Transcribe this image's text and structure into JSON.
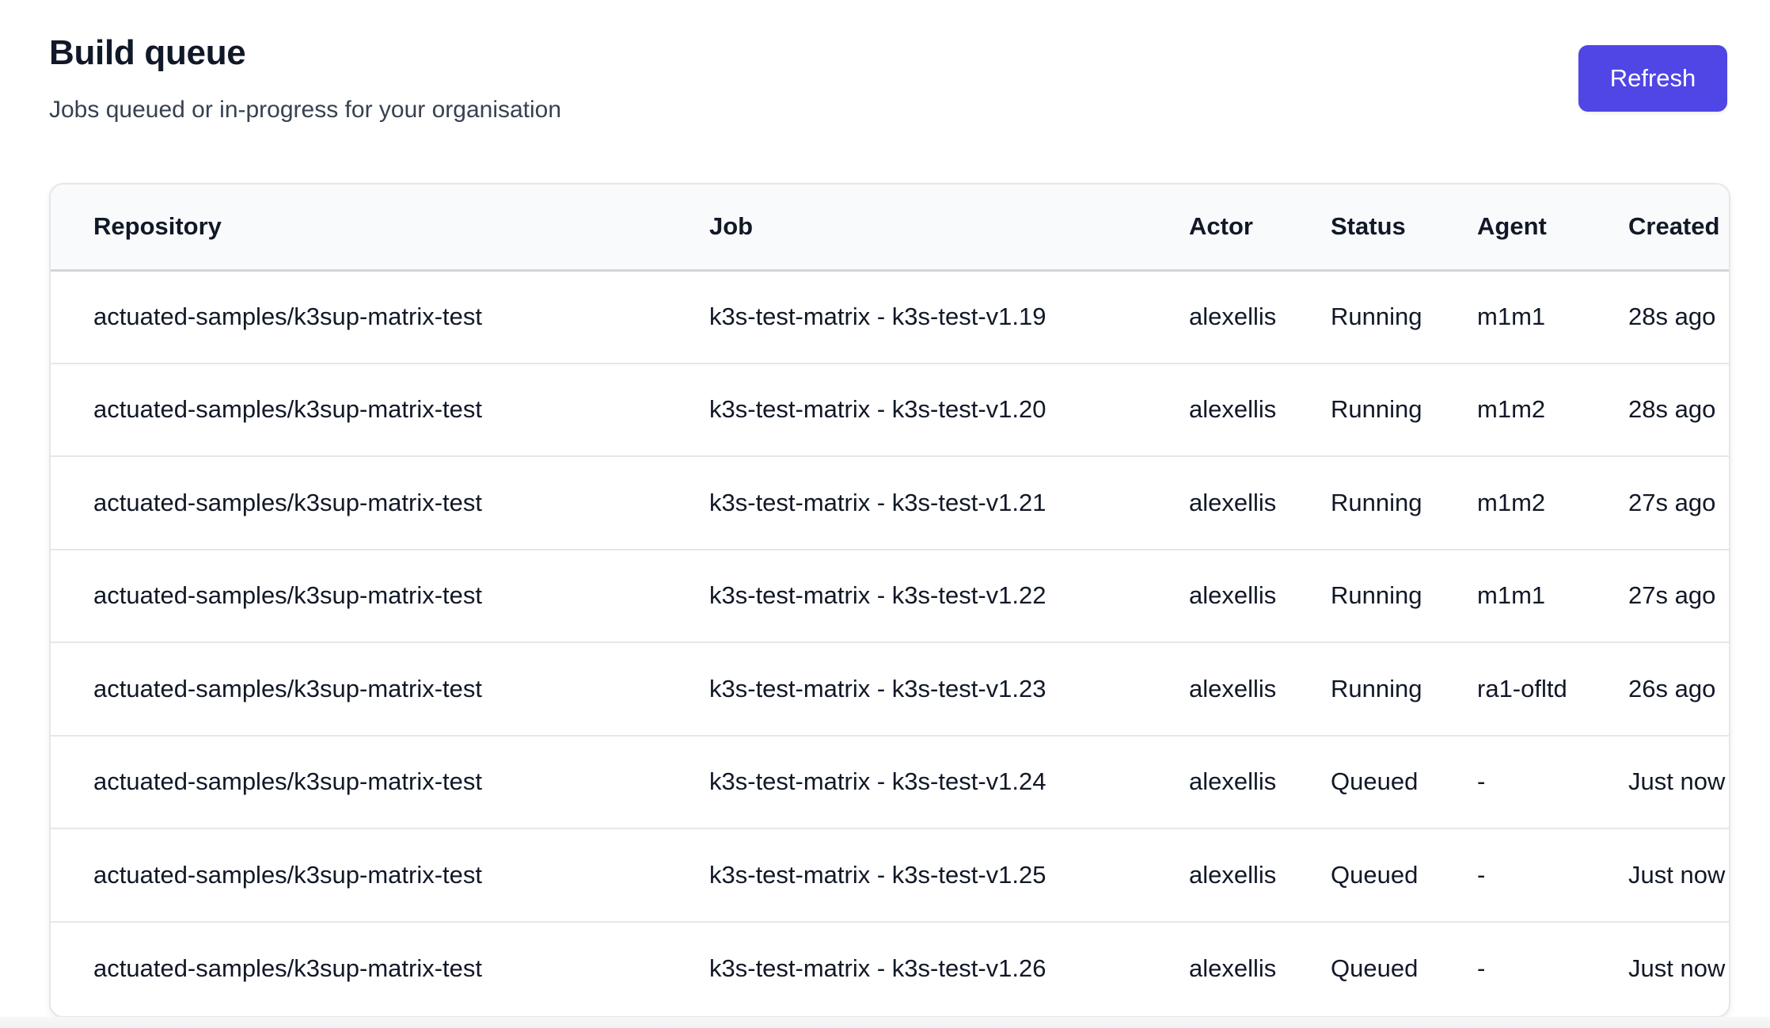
{
  "header": {
    "title": "Build queue",
    "subtitle": "Jobs queued or in-progress for your organisation",
    "refresh_label": "Refresh"
  },
  "colors": {
    "accent": "#4f46e5",
    "text_primary": "#111827",
    "text_secondary": "#374151",
    "header_bg": "#f9fafb",
    "border": "#e5e7eb"
  },
  "table": {
    "columns": [
      "Repository",
      "Job",
      "Actor",
      "Status",
      "Agent",
      "Created"
    ],
    "rows": [
      {
        "repository": "actuated-samples/k3sup-matrix-test",
        "job": "k3s-test-matrix - k3s-test-v1.19",
        "actor": "alexellis",
        "status": "Running",
        "agent": "m1m1",
        "created": "28s ago"
      },
      {
        "repository": "actuated-samples/k3sup-matrix-test",
        "job": "k3s-test-matrix - k3s-test-v1.20",
        "actor": "alexellis",
        "status": "Running",
        "agent": "m1m2",
        "created": "28s ago"
      },
      {
        "repository": "actuated-samples/k3sup-matrix-test",
        "job": "k3s-test-matrix - k3s-test-v1.21",
        "actor": "alexellis",
        "status": "Running",
        "agent": "m1m2",
        "created": "27s ago"
      },
      {
        "repository": "actuated-samples/k3sup-matrix-test",
        "job": "k3s-test-matrix - k3s-test-v1.22",
        "actor": "alexellis",
        "status": "Running",
        "agent": "m1m1",
        "created": "27s ago"
      },
      {
        "repository": "actuated-samples/k3sup-matrix-test",
        "job": "k3s-test-matrix - k3s-test-v1.23",
        "actor": "alexellis",
        "status": "Running",
        "agent": "ra1-ofltd",
        "created": "26s ago"
      },
      {
        "repository": "actuated-samples/k3sup-matrix-test",
        "job": "k3s-test-matrix - k3s-test-v1.24",
        "actor": "alexellis",
        "status": "Queued",
        "agent": "-",
        "created": "Just now"
      },
      {
        "repository": "actuated-samples/k3sup-matrix-test",
        "job": "k3s-test-matrix - k3s-test-v1.25",
        "actor": "alexellis",
        "status": "Queued",
        "agent": "-",
        "created": "Just now"
      },
      {
        "repository": "actuated-samples/k3sup-matrix-test",
        "job": "k3s-test-matrix - k3s-test-v1.26",
        "actor": "alexellis",
        "status": "Queued",
        "agent": "-",
        "created": "Just now"
      }
    ]
  }
}
